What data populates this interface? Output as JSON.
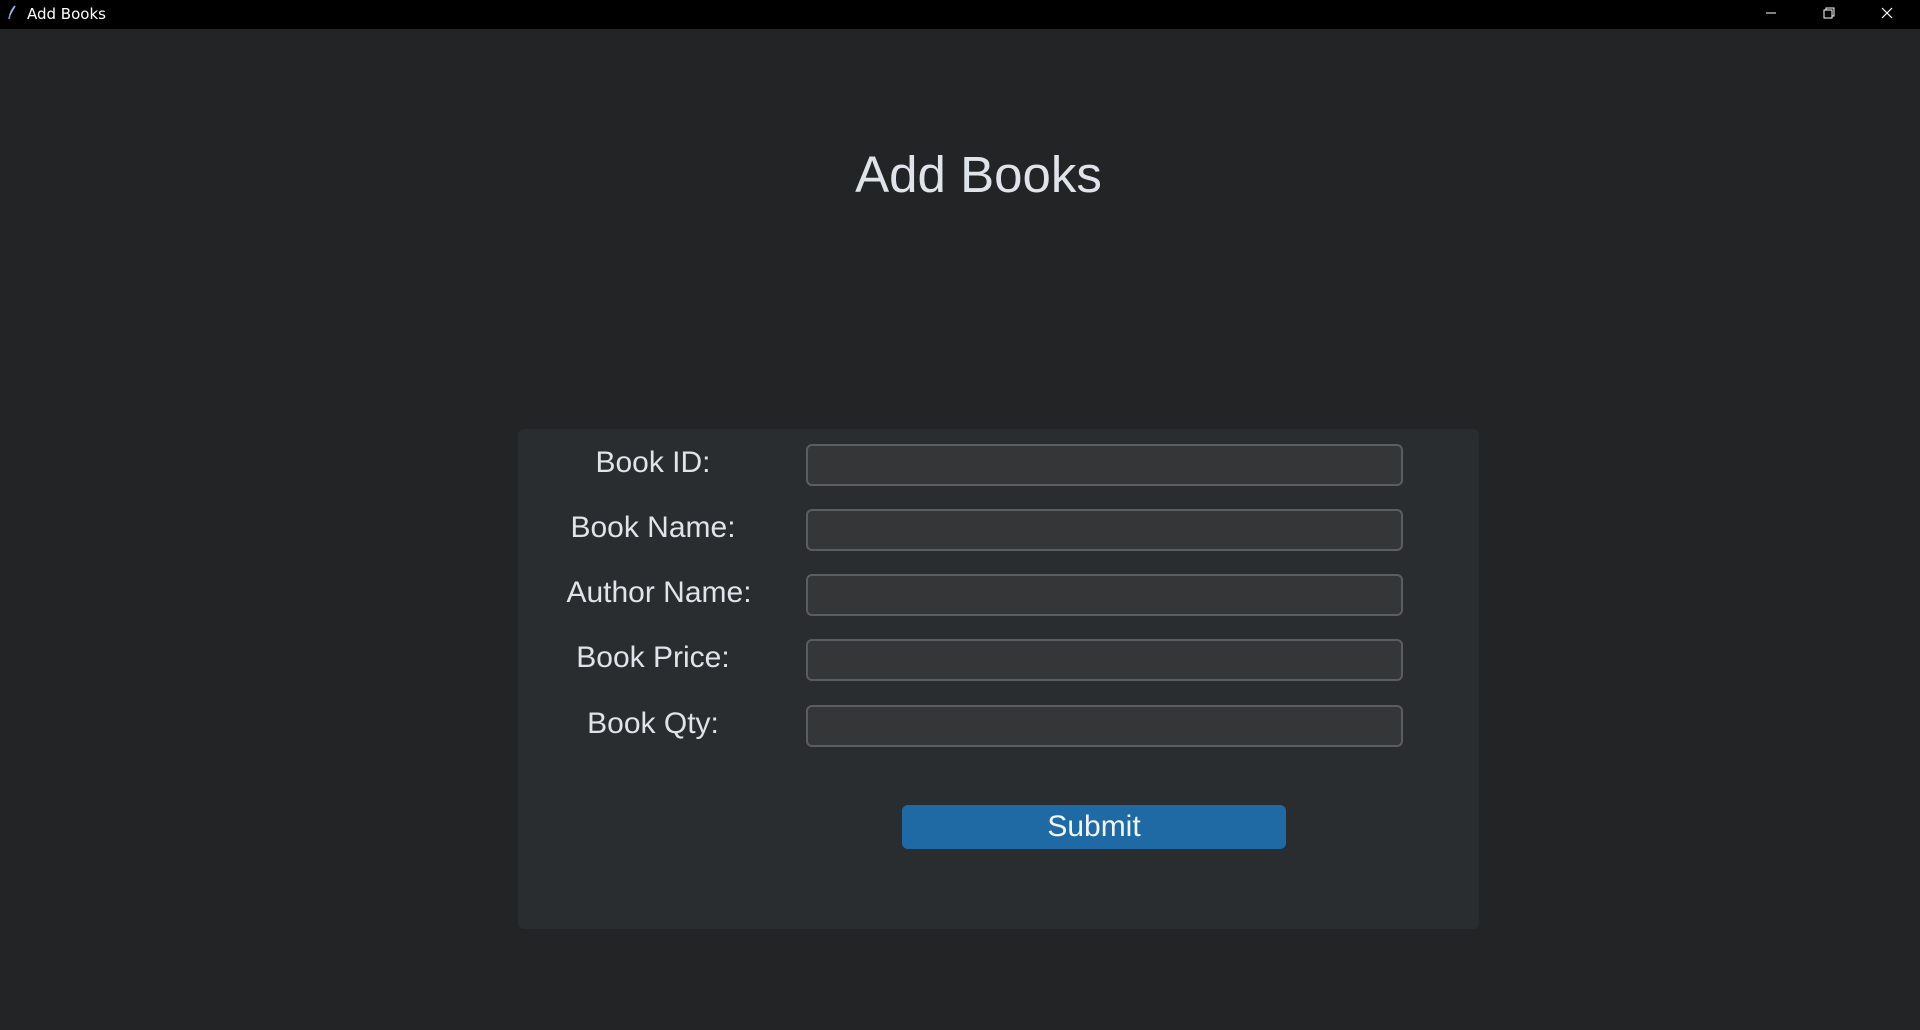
{
  "window": {
    "title": "Add Books",
    "app_icon": "feather-icon",
    "controls": {
      "minimize_icon": "minimize-icon",
      "maximize_icon": "restore-icon",
      "close_icon": "close-icon"
    }
  },
  "heading": "Add Books",
  "form": {
    "fields": [
      {
        "label": "Book ID:",
        "value": "",
        "placeholder": ""
      },
      {
        "label": "Book Name:",
        "value": "",
        "placeholder": ""
      },
      {
        "label": "Author Name:",
        "value": "",
        "placeholder": ""
      },
      {
        "label": "Book Price:",
        "value": "",
        "placeholder": ""
      },
      {
        "label": "Book Qty:",
        "value": "",
        "placeholder": ""
      }
    ],
    "submit_label": "Submit"
  },
  "colors": {
    "background": "#222426",
    "panel": "#2a2d30",
    "input": "#343638",
    "accent": "#1f6aa5",
    "text": "#dfe3ea"
  }
}
